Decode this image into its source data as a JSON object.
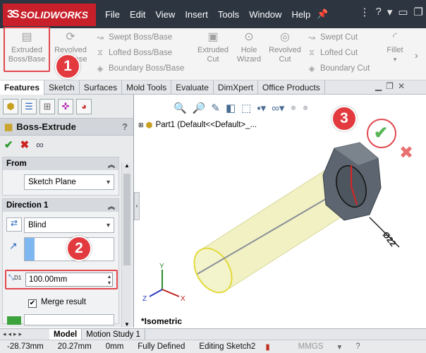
{
  "app": {
    "logo_text": "SOLIDWORKS",
    "logo_glyph": "3S"
  },
  "menu": [
    "File",
    "Edit",
    "View",
    "Insert",
    "Tools",
    "Window",
    "Help"
  ],
  "ribbon": {
    "extruded": [
      "Extruded",
      "Boss/Base"
    ],
    "revolved": [
      "Revolved",
      "Base"
    ],
    "swept": "Swept Boss/Base",
    "lofted": "Lofted Boss/Base",
    "boundary": "Boundary Boss/Base",
    "extruded_cut": [
      "Extruded",
      "Cut"
    ],
    "hole_wizard": [
      "Hole",
      "Wizard"
    ],
    "revolved_cut": [
      "Revolved",
      "Cut"
    ],
    "swept_cut": "Swept Cut",
    "lofted_cut": "Lofted Cut",
    "boundary_cut": "Boundary Cut",
    "fillet": "Fillet"
  },
  "tabs": [
    "Features",
    "Sketch",
    "Surfaces",
    "Mold Tools",
    "Evaluate",
    "DimXpert",
    "Office Products"
  ],
  "pm": {
    "title": "Boss-Extrude",
    "help": "?",
    "from": {
      "label": "From",
      "value": "Sketch Plane"
    },
    "direction1": {
      "label": "Direction 1",
      "end_condition": "Blind",
      "depth": "100.00mm",
      "depth_label": "D1"
    },
    "merge_result": "Merge result"
  },
  "graphics": {
    "tree_root": "Part1  (Default<<Default>_...",
    "view_label": "*Isometric",
    "dimension": "Ø22",
    "axes": {
      "x": "X",
      "y": "Y",
      "z": "Z"
    }
  },
  "badges": [
    "1",
    "2",
    "3"
  ],
  "bottom_tabs": [
    "Model",
    "Motion Study 1"
  ],
  "status": {
    "x": "-28.73mm",
    "y": "20.27mm",
    "z": "0mm",
    "state": "Fully Defined",
    "editing": "Editing Sketch2",
    "units": "MMGS"
  },
  "colors": {
    "badge": "#e23a3f",
    "cylinder": "#f1f1c4",
    "nut": "#5d6670",
    "accent_red": "#c8202a"
  }
}
